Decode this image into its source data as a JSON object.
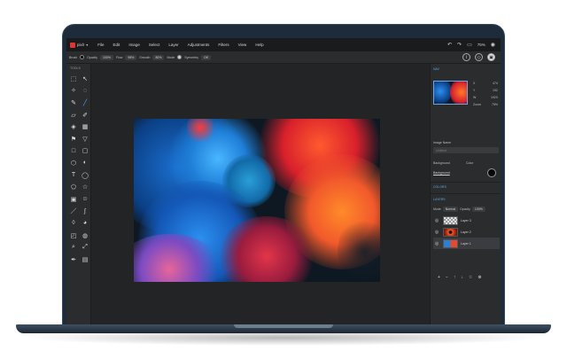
{
  "app": {
    "name": "pixlr"
  },
  "menubar": {
    "items": [
      "File",
      "Edit",
      "Image",
      "Select",
      "Layer",
      "Adjustments",
      "Filters",
      "View",
      "Help"
    ],
    "zoom": "75%"
  },
  "options": {
    "tool": "Brush",
    "opacity_label": "Opacity",
    "opacity_value": "100%",
    "flow_label": "Flow",
    "flow_value": "98%",
    "smoothing_label": "Smooth",
    "smoothing_value": "80%",
    "mode_label": "Mode",
    "symmetry_label": "Symmetry",
    "symmetry_value": "Off"
  },
  "toolbar": {
    "title": "TOOLS",
    "tools": [
      {
        "icon": "move-icon",
        "glyph": "⬚"
      },
      {
        "icon": "select-arrow-icon",
        "glyph": "↖"
      },
      {
        "icon": "magic-wand-icon",
        "glyph": "✧"
      },
      {
        "icon": "lasso-icon",
        "glyph": "◌"
      },
      {
        "icon": "pen-icon",
        "glyph": "✎"
      },
      {
        "icon": "brush-icon",
        "glyph": "╱",
        "active": true
      },
      {
        "icon": "eraser-icon",
        "glyph": "▱"
      },
      {
        "icon": "pencil-icon",
        "glyph": "✐"
      },
      {
        "icon": "fill-icon",
        "glyph": "◈"
      },
      {
        "icon": "gradient-icon",
        "glyph": "▦"
      },
      {
        "icon": "stamp-icon",
        "glyph": "⚑"
      },
      {
        "icon": "filter-icon",
        "glyph": "▽"
      },
      {
        "icon": "rect-icon",
        "glyph": "□"
      },
      {
        "icon": "frame-icon",
        "glyph": "▢"
      },
      {
        "icon": "blob-icon",
        "glyph": "⬡"
      },
      {
        "icon": "dodge-icon",
        "glyph": "◐"
      },
      {
        "icon": "text-icon",
        "glyph": "T"
      },
      {
        "icon": "shape-icon",
        "glyph": "◯"
      },
      {
        "icon": "polygon-icon",
        "glyph": "⬠"
      },
      {
        "icon": "star-icon",
        "glyph": "☆"
      },
      {
        "icon": "camera-icon",
        "glyph": "▣"
      },
      {
        "icon": "smile-icon",
        "glyph": "☺"
      },
      {
        "icon": "line-icon",
        "glyph": "／"
      },
      {
        "icon": "warp-icon",
        "glyph": "∫"
      },
      {
        "icon": "drop-icon",
        "glyph": "◊"
      },
      {
        "icon": "burn-icon",
        "glyph": "◕"
      },
      {
        "icon": "crop-icon",
        "glyph": "◰"
      },
      {
        "icon": "eyedrop-outline-icon",
        "glyph": "◍"
      },
      {
        "icon": "zoom-icon",
        "glyph": "⌕"
      },
      {
        "icon": "fullscreen-icon",
        "glyph": "⤢"
      },
      {
        "icon": "eyedropper-icon",
        "glyph": "✒"
      },
      {
        "icon": "trash-icon",
        "glyph": "▤"
      }
    ]
  },
  "panel": {
    "nav_title": "NAV",
    "x_label": "X",
    "x_value": "474",
    "y_label": "Y",
    "y_value": "192",
    "w_label": "W",
    "w_value": "1920",
    "h_label": "H",
    "h_value": "1281",
    "zoom_label": "Zoom",
    "zoom_value": "75%",
    "image_name_label": "Image Name",
    "image_name_placeholder": "Untitled",
    "background_label": "Background",
    "color_label": "Color",
    "colors_title": "COLORS",
    "layers_title": "LAYERS",
    "mode_label": "Mode",
    "mode_value": "Normal",
    "opacity_label": "Opacity",
    "opacity_value": "100%",
    "layers": [
      {
        "name": "Layer 3",
        "thumb": "checker"
      },
      {
        "name": "Layer 2",
        "thumb": "orange"
      },
      {
        "name": "Layer 1",
        "thumb": "ink",
        "selected": true
      }
    ],
    "actions": [
      "+",
      "−",
      "↑",
      "↓",
      "☆",
      "⊗"
    ]
  },
  "colors": {
    "accent": "#4aa3ff",
    "ink_blue": "#1f8bea",
    "ink_orange": "#f2592b",
    "ink_red": "#d8202c"
  }
}
